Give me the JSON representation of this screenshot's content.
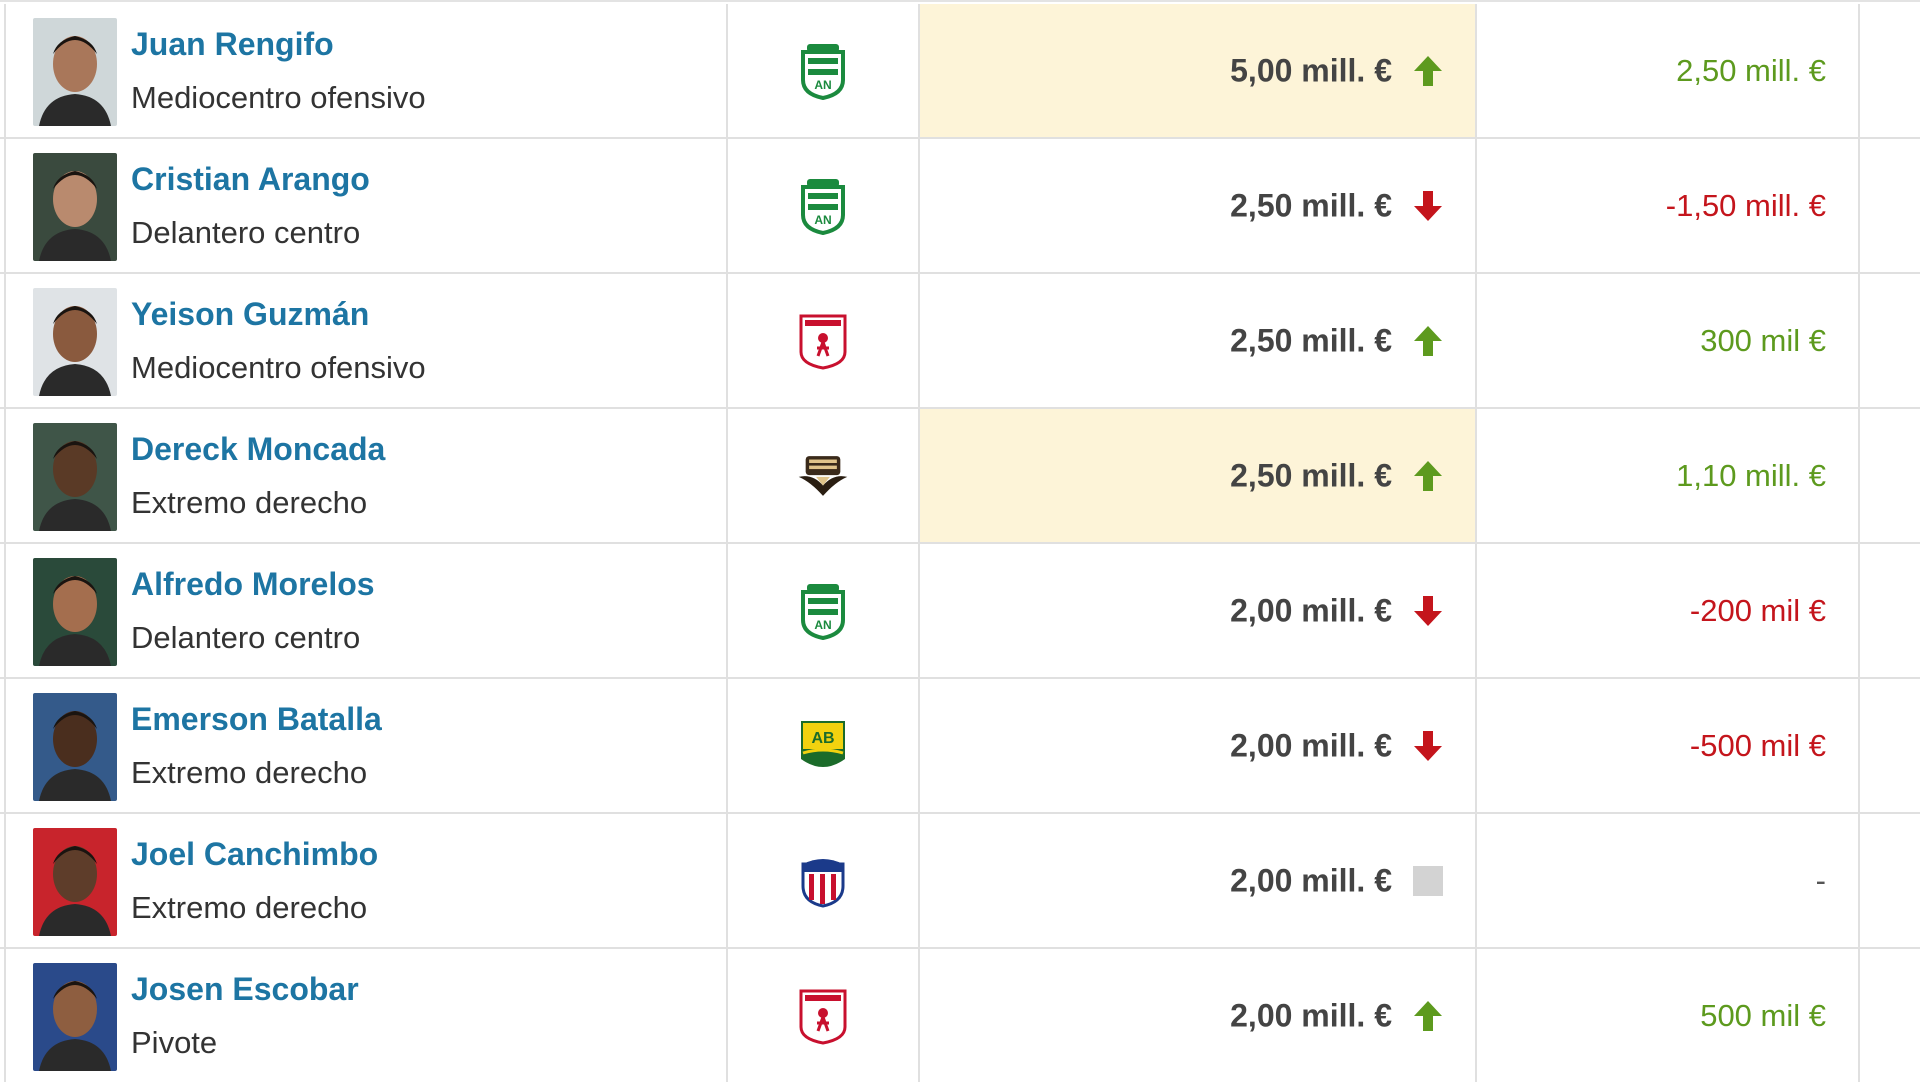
{
  "colors": {
    "link": "#1d75a3",
    "up": "#5d9a1e",
    "down": "#c4151c",
    "highlight": "#fdf4d8"
  },
  "rows": [
    {
      "name": "Juan Rengifo",
      "position": "Mediocentro ofensivo",
      "club_icon": "atletico-nacional-crest-icon",
      "market_value": "5,00 mill. €",
      "trend": "up",
      "difference": "2,50 mill. €",
      "highlight": true
    },
    {
      "name": "Cristian Arango",
      "position": "Delantero centro",
      "club_icon": "atletico-nacional-crest-icon",
      "market_value": "2,50 mill. €",
      "trend": "down",
      "difference": "-1,50 mill. €",
      "highlight": false
    },
    {
      "name": "Yeison Guzmán",
      "position": "Mediocentro ofensivo",
      "club_icon": "america-de-cali-crest-icon",
      "market_value": "2,50 mill. €",
      "trend": "up",
      "difference": "300 mil €",
      "highlight": false
    },
    {
      "name": "Dereck Moncada",
      "position": "Extremo derecho",
      "club_icon": "once-caldas-crest-icon",
      "market_value": "2,50 mill. €",
      "trend": "up",
      "difference": "1,10 mill. €",
      "highlight": true
    },
    {
      "name": "Alfredo Morelos",
      "position": "Delantero centro",
      "club_icon": "atletico-nacional-crest-icon",
      "market_value": "2,00 mill. €",
      "trend": "down",
      "difference": "-200 mil €",
      "highlight": false
    },
    {
      "name": "Emerson Batalla",
      "position": "Extremo derecho",
      "club_icon": "atletico-bucaramanga-crest-icon",
      "market_value": "2,00 mill. €",
      "trend": "down",
      "difference": "-500 mil €",
      "highlight": false
    },
    {
      "name": "Joel Canchimbo",
      "position": "Extremo derecho",
      "club_icon": "junior-barranquilla-crest-icon",
      "market_value": "2,00 mill. €",
      "trend": "none",
      "difference": "-",
      "highlight": false
    },
    {
      "name": "Josen Escobar",
      "position": "Pivote",
      "club_icon": "america-de-cali-crest-icon",
      "market_value": "2,00 mill. €",
      "trend": "up",
      "difference": "500 mil €",
      "highlight": false
    }
  ]
}
